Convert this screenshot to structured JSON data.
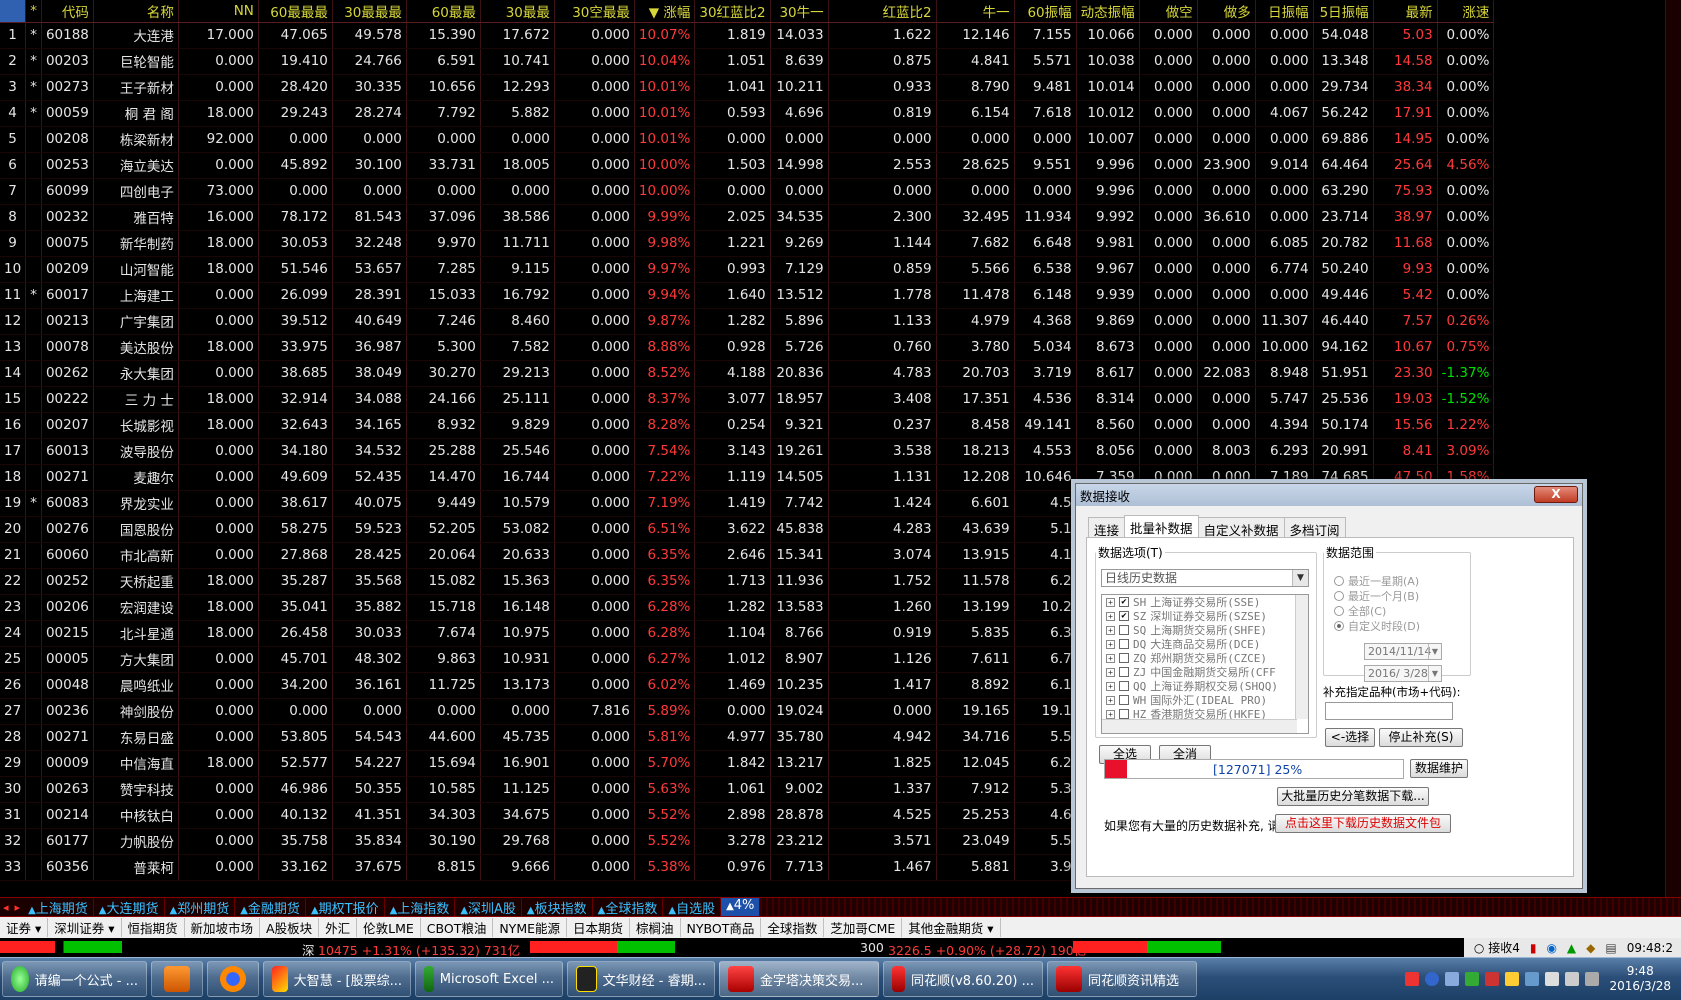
{
  "grid": {
    "headers": [
      "",
      "*",
      "代码",
      "名称",
      "NN",
      "60最最最",
      "30最最最",
      "60最最",
      "30最最",
      "30空最最",
      "▼ 涨幅",
      "30红蓝比2",
      "30牛一",
      "红蓝比2",
      "牛一",
      "60振幅",
      "动态振幅",
      "做空",
      "做多",
      "日振幅",
      "5日振幅",
      "最新",
      "涨速"
    ],
    "rows": [
      [
        "1",
        "*",
        "60188",
        "大连港",
        "17.000",
        "47.065",
        "49.578",
        "15.390",
        "17.672",
        "0.000",
        "10.07%",
        "1.819",
        "14.033",
        "1.622",
        "12.146",
        "7.155",
        "10.066",
        "0.000",
        "0.000",
        "0.000",
        "54.048",
        "5.03",
        "0.00%"
      ],
      [
        "2",
        "*",
        "00203",
        "巨轮智能",
        "0.000",
        "19.410",
        "24.766",
        "6.591",
        "10.741",
        "0.000",
        "10.04%",
        "1.051",
        "8.639",
        "0.875",
        "4.841",
        "5.571",
        "10.038",
        "0.000",
        "0.000",
        "0.000",
        "13.348",
        "14.58",
        "0.00%"
      ],
      [
        "3",
        "*",
        "00273",
        "王子新材",
        "0.000",
        "28.420",
        "30.335",
        "10.656",
        "12.293",
        "0.000",
        "10.01%",
        "1.041",
        "10.211",
        "0.933",
        "8.790",
        "9.481",
        "10.014",
        "0.000",
        "0.000",
        "0.000",
        "29.734",
        "38.34",
        "0.00%"
      ],
      [
        "4",
        "*",
        "00059",
        "桐 君 阁",
        "18.000",
        "29.243",
        "28.274",
        "7.792",
        "5.882",
        "0.000",
        "10.01%",
        "0.593",
        "4.696",
        "0.819",
        "6.154",
        "7.618",
        "10.012",
        "0.000",
        "0.000",
        "4.067",
        "56.242",
        "17.91",
        "0.00%"
      ],
      [
        "5",
        "",
        "00208",
        "栋梁新材",
        "92.000",
        "0.000",
        "0.000",
        "0.000",
        "0.000",
        "0.000",
        "10.01%",
        "0.000",
        "0.000",
        "0.000",
        "0.000",
        "0.000",
        "10.007",
        "0.000",
        "0.000",
        "0.000",
        "69.886",
        "14.95",
        "0.00%"
      ],
      [
        "6",
        "",
        "00253",
        "海立美达",
        "0.000",
        "45.892",
        "30.100",
        "33.731",
        "18.005",
        "0.000",
        "10.00%",
        "1.503",
        "14.998",
        "2.553",
        "28.625",
        "9.551",
        "9.996",
        "0.000",
        "23.900",
        "9.014",
        "64.464",
        "25.64",
        "4.56%"
      ],
      [
        "7",
        "",
        "60099",
        "四创电子",
        "73.000",
        "0.000",
        "0.000",
        "0.000",
        "0.000",
        "0.000",
        "10.00%",
        "0.000",
        "0.000",
        "0.000",
        "0.000",
        "0.000",
        "9.996",
        "0.000",
        "0.000",
        "0.000",
        "63.290",
        "75.93",
        "0.00%"
      ],
      [
        "8",
        "",
        "00232",
        "雅百特",
        "16.000",
        "78.172",
        "81.543",
        "37.096",
        "38.586",
        "0.000",
        "9.99%",
        "2.025",
        "34.535",
        "2.300",
        "32.495",
        "11.934",
        "9.992",
        "0.000",
        "36.610",
        "0.000",
        "23.714",
        "38.97",
        "0.00%"
      ],
      [
        "9",
        "",
        "00075",
        "新华制药",
        "18.000",
        "30.053",
        "32.248",
        "9.970",
        "11.711",
        "0.000",
        "9.98%",
        "1.221",
        "9.269",
        "1.144",
        "7.682",
        "6.648",
        "9.981",
        "0.000",
        "0.000",
        "6.085",
        "20.782",
        "11.68",
        "0.00%"
      ],
      [
        "10",
        "",
        "00209",
        "山河智能",
        "18.000",
        "51.546",
        "53.657",
        "7.285",
        "9.115",
        "0.000",
        "9.97%",
        "0.993",
        "7.129",
        "0.859",
        "5.566",
        "6.538",
        "9.967",
        "0.000",
        "0.000",
        "6.774",
        "50.240",
        "9.93",
        "0.00%"
      ],
      [
        "11",
        "*",
        "60017",
        "上海建工",
        "0.000",
        "26.099",
        "28.391",
        "15.033",
        "16.792",
        "0.000",
        "9.94%",
        "1.640",
        "13.512",
        "1.778",
        "11.478",
        "6.148",
        "9.939",
        "0.000",
        "0.000",
        "0.000",
        "49.446",
        "5.42",
        "0.00%"
      ],
      [
        "12",
        "",
        "00213",
        "广宇集团",
        "0.000",
        "39.512",
        "40.649",
        "7.246",
        "8.460",
        "0.000",
        "9.87%",
        "1.282",
        "5.896",
        "1.133",
        "4.979",
        "4.368",
        "9.869",
        "0.000",
        "0.000",
        "11.307",
        "46.440",
        "7.57",
        "0.26%"
      ],
      [
        "13",
        "",
        "00078",
        "美达股份",
        "18.000",
        "33.975",
        "36.987",
        "5.300",
        "7.582",
        "0.000",
        "8.88%",
        "0.928",
        "5.726",
        "0.760",
        "3.780",
        "5.034",
        "8.673",
        "0.000",
        "0.000",
        "10.000",
        "94.162",
        "10.67",
        "0.75%"
      ],
      [
        "14",
        "",
        "00262",
        "永大集团",
        "0.000",
        "38.685",
        "38.049",
        "30.270",
        "29.213",
        "0.000",
        "8.52%",
        "4.188",
        "20.836",
        "4.783",
        "20.703",
        "3.719",
        "8.617",
        "0.000",
        "22.083",
        "8.948",
        "51.951",
        "23.30",
        "-1.37%"
      ],
      [
        "15",
        "",
        "00222",
        "三 力 士",
        "18.000",
        "32.914",
        "34.088",
        "24.166",
        "25.111",
        "0.000",
        "8.37%",
        "3.077",
        "18.957",
        "3.408",
        "17.351",
        "4.536",
        "8.314",
        "0.000",
        "0.000",
        "5.747",
        "25.536",
        "19.03",
        "-1.52%"
      ],
      [
        "16",
        "",
        "00207",
        "长城影视",
        "18.000",
        "32.643",
        "34.165",
        "8.932",
        "9.829",
        "0.000",
        "8.28%",
        "0.254",
        "9.321",
        "0.237",
        "8.458",
        "49.141",
        "8.560",
        "0.000",
        "0.000",
        "4.394",
        "50.174",
        "15.56",
        "1.22%"
      ],
      [
        "17",
        "",
        "60013",
        "波导股份",
        "0.000",
        "34.180",
        "34.532",
        "25.288",
        "25.546",
        "0.000",
        "7.54%",
        "3.143",
        "19.261",
        "3.538",
        "18.213",
        "4.553",
        "8.056",
        "0.000",
        "8.003",
        "6.293",
        "20.991",
        "8.41",
        "3.09%"
      ],
      [
        "18",
        "",
        "00271",
        "麦趣尔",
        "0.000",
        "49.609",
        "52.435",
        "14.470",
        "16.744",
        "0.000",
        "7.22%",
        "1.119",
        "14.505",
        "1.131",
        "12.208",
        "10.646",
        "7.359",
        "0.000",
        "0.000",
        "7.189",
        "74.685",
        "47.50",
        "1.58%"
      ],
      [
        "19",
        "*",
        "60083",
        "界龙实业",
        "0.000",
        "38.617",
        "40.075",
        "9.449",
        "10.579",
        "0.000",
        "7.19%",
        "1.419",
        "7.742",
        "1.424",
        "6.601",
        "4.5",
        "",
        "",
        "",
        "",
        "",
        "",
        ""
      ],
      [
        "20",
        "",
        "00276",
        "国恩股份",
        "0.000",
        "58.275",
        "59.523",
        "52.205",
        "53.082",
        "0.000",
        "6.51%",
        "3.622",
        "45.838",
        "4.283",
        "43.639",
        "5.1",
        "",
        "",
        "",
        "",
        "",
        "",
        ""
      ],
      [
        "21",
        "",
        "60060",
        "市北高新",
        "0.000",
        "27.868",
        "28.425",
        "20.064",
        "20.633",
        "0.000",
        "6.35%",
        "2.646",
        "15.341",
        "3.074",
        "13.915",
        "4.1",
        "",
        "",
        "",
        "",
        "",
        "",
        ""
      ],
      [
        "22",
        "",
        "00252",
        "天桥起重",
        "18.000",
        "35.287",
        "35.568",
        "15.082",
        "15.363",
        "0.000",
        "6.35%",
        "1.713",
        "11.936",
        "1.752",
        "11.578",
        "6.2",
        "",
        "",
        "",
        "",
        "",
        "",
        ""
      ],
      [
        "23",
        "",
        "00206",
        "宏润建设",
        "18.000",
        "35.041",
        "35.882",
        "15.718",
        "16.148",
        "0.000",
        "6.28%",
        "1.282",
        "13.583",
        "1.260",
        "13.199",
        "10.2",
        "",
        "",
        "",
        "",
        "",
        "",
        ""
      ],
      [
        "24",
        "",
        "00215",
        "北斗星通",
        "18.000",
        "26.458",
        "30.033",
        "7.674",
        "10.975",
        "0.000",
        "6.28%",
        "1.104",
        "8.766",
        "0.919",
        "5.835",
        "6.3",
        "",
        "",
        "",
        "",
        "",
        "",
        ""
      ],
      [
        "25",
        "",
        "00005",
        "方大集团",
        "0.000",
        "45.701",
        "48.302",
        "9.863",
        "10.931",
        "0.000",
        "6.27%",
        "1.012",
        "8.907",
        "1.126",
        "7.611",
        "6.7",
        "",
        "",
        "",
        "",
        "",
        "",
        ""
      ],
      [
        "26",
        "",
        "00048",
        "晨鸣纸业",
        "0.000",
        "34.200",
        "36.161",
        "11.725",
        "13.173",
        "0.000",
        "6.02%",
        "1.469",
        "10.235",
        "1.417",
        "8.892",
        "6.1",
        "",
        "",
        "",
        "",
        "",
        "",
        ""
      ],
      [
        "27",
        "",
        "00236",
        "神剑股份",
        "0.000",
        "0.000",
        "0.000",
        "0.000",
        "0.000",
        "7.816",
        "5.89%",
        "0.000",
        "19.024",
        "0.000",
        "19.165",
        "19.1",
        "",
        "",
        "",
        "",
        "",
        "",
        ""
      ],
      [
        "28",
        "",
        "00271",
        "东易日盛",
        "0.000",
        "53.805",
        "54.543",
        "44.600",
        "45.735",
        "0.000",
        "5.81%",
        "4.977",
        "35.780",
        "4.942",
        "34.716",
        "5.5",
        "",
        "",
        "",
        "",
        "",
        "",
        ""
      ],
      [
        "29",
        "",
        "00009",
        "中信海直",
        "18.000",
        "52.577",
        "54.227",
        "15.694",
        "16.901",
        "0.000",
        "5.70%",
        "1.842",
        "13.217",
        "1.825",
        "12.045",
        "6.2",
        "",
        "",
        "",
        "",
        "",
        "",
        ""
      ],
      [
        "30",
        "",
        "00263",
        "赞宇科技",
        "0.000",
        "46.986",
        "50.355",
        "10.585",
        "11.125",
        "0.000",
        "5.63%",
        "1.061",
        "9.002",
        "1.337",
        "7.912",
        "5.3",
        "",
        "",
        "",
        "",
        "",
        "",
        ""
      ],
      [
        "31",
        "",
        "00214",
        "中核钛白",
        "0.000",
        "40.132",
        "41.351",
        "34.303",
        "34.675",
        "0.000",
        "5.52%",
        "2.898",
        "28.878",
        "4.525",
        "25.253",
        "4.6",
        "",
        "",
        "",
        "",
        "",
        "",
        ""
      ],
      [
        "32",
        "",
        "60177",
        "力帆股份",
        "0.000",
        "35.758",
        "35.834",
        "30.190",
        "29.768",
        "0.000",
        "5.52%",
        "3.278",
        "23.212",
        "3.571",
        "23.049",
        "5.5",
        "",
        "",
        "",
        "",
        "",
        "",
        ""
      ],
      [
        "33",
        "",
        "60356",
        "普莱柯",
        "0.000",
        "33.162",
        "37.675",
        "8.815",
        "9.666",
        "0.000",
        "5.38%",
        "0.976",
        "7.713",
        "1.467",
        "5.881",
        "3.9",
        "",
        "",
        "",
        "",
        "",
        "",
        ""
      ]
    ]
  },
  "market_tabs": [
    "上海期货",
    "大连期货",
    "郑州期货",
    "金融期货",
    "期权T报价",
    "上海指数",
    "深圳A股",
    "板块指数",
    "全球指数",
    "自选股",
    "4%"
  ],
  "lower_menu": [
    "证券 ▾",
    "深圳证券 ▾",
    "恒指期货",
    "新加坡市场",
    "A股板块",
    "外汇",
    "伦敦LME",
    "CBOT粮油",
    "NYME能源",
    "日本期货",
    "棕榈油",
    "NYBOT商品",
    "全球指数",
    "芝加哥CME",
    "其他金融期货 ▾"
  ],
  "status": {
    "sz_label": "深",
    "sz_text": "10475 +1.31% (+135.32) 731亿",
    "hs_label": "300",
    "hs_text": "3226.5 +0.90% (+28.72) 190亿",
    "recv": "接收4",
    "time": "09:48:2"
  },
  "taskbar": {
    "items": [
      "请编一个公式 - ...",
      "",
      "",
      "大智慧 - [股票综...",
      "Microsoft Excel ...",
      "文华财经 - 睿期...",
      "金字塔决策交易...",
      "同花顺(v8.60.20) ...",
      "同花顺资讯精选"
    ],
    "clock_time": "9:48",
    "clock_date": "2016/3/28"
  },
  "dialog": {
    "title": "数据接收",
    "close": "X",
    "tabs": [
      "连接",
      "批量补数据",
      "自定义补数据",
      "多档订阅"
    ],
    "data_options_label": "数据选项(T)",
    "data_type": "日线历史数据",
    "exchanges": [
      {
        "code": "SH",
        "name": "上海证券交易所(SSE)",
        "checked": true
      },
      {
        "code": "SZ",
        "name": "深圳证券交易所(SZSE)",
        "checked": true
      },
      {
        "code": "SQ",
        "name": "上海期货交易所(SHFE)",
        "checked": false
      },
      {
        "code": "DQ",
        "name": "大连商品交易所(DCE)",
        "checked": false
      },
      {
        "code": "ZQ",
        "name": "郑州期货交易所(CZCE)",
        "checked": false
      },
      {
        "code": "ZJ",
        "name": "中国金融期货交易所(CFF",
        "checked": false
      },
      {
        "code": "QQ",
        "name": "上海证券期权交易(SHQQ)",
        "checked": false
      },
      {
        "code": "WH",
        "name": "国际外汇(IDEAL PRO)",
        "checked": false
      },
      {
        "code": "HZ",
        "name": "香港期货交易所(HKFE)",
        "checked": false
      }
    ],
    "select_all": "全选",
    "clear_all": "全消",
    "range_label": "数据范围",
    "range_options": [
      "最近一星期(A)",
      "最近一个月(B)",
      "全部(C)",
      "自定义时段(D)"
    ],
    "range_selected": 3,
    "date_from": "2014/11/14",
    "date_to": "2016/ 3/28",
    "supplement_label": "补充指定品种(市场+代码):",
    "choose_btn": "<-选择",
    "stop_btn": "停止补充(S)",
    "progress_text": "[127071] 25%",
    "progress_fraction": 0.25,
    "maintain_btn": "数据维护",
    "bulk_btn": "大批量历史分笔数据下载...",
    "hint_text": "如果您有大量的历史数据补充, 请",
    "download_btn": "点击这里下载历史数据文件包"
  },
  "colors": {
    "up": "#ff3a3a",
    "down": "#00e000",
    "header": "#d6d63a",
    "grid_bg": "#000000"
  }
}
